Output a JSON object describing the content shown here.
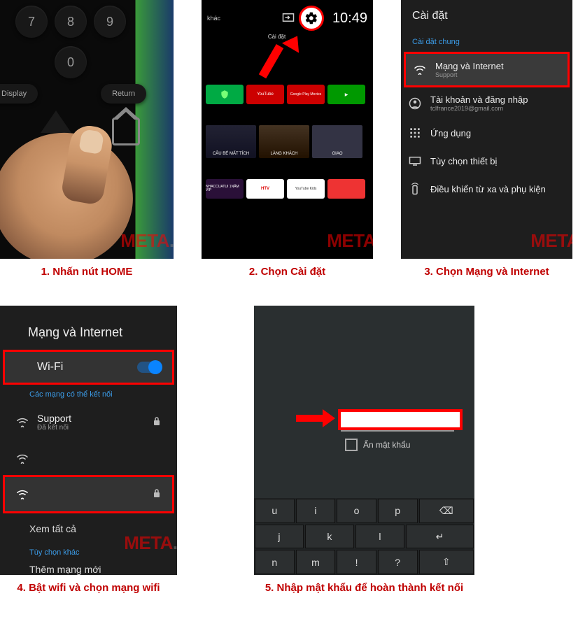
{
  "step1": {
    "caption": "1. Nhấn nút HOME",
    "remote": {
      "keys_row1": [
        "7",
        "8",
        "9"
      ],
      "key_zero": "0",
      "display_btn": "Display",
      "return_btn": "Return"
    }
  },
  "step2": {
    "caption": "2. Chọn Cài đặt",
    "topbar": {
      "khac": "khác",
      "time": "10:49",
      "settings_label": "Cài đặt"
    },
    "apps_row1": [
      {
        "label": "",
        "color": "#0a4"
      },
      {
        "label": "YouTube",
        "color": "#c00"
      },
      {
        "label": "Google Play Movies",
        "color": "#c00"
      },
      {
        "label": "",
        "color": "#090"
      }
    ],
    "posters_row1": [
      {
        "label": "CÂU BÉ MẤT TÍCH"
      },
      {
        "label": "LÀNG KHÁCH"
      },
      {
        "label": "GIAO"
      }
    ],
    "apps_row2": [
      {
        "label": "NHACCUATUI 1NĂM VIP",
        "color": "#2a1038"
      },
      {
        "label": "HTV",
        "color": "#d00"
      },
      {
        "label": "YouTube Kids",
        "color": "#fff"
      },
      {
        "label": "",
        "color": "#e33"
      }
    ]
  },
  "step3": {
    "caption": "3. Chọn Mạng và Internet",
    "header": "Cài đặt",
    "section": "Cài đặt chung",
    "items": [
      {
        "icon": "wifi",
        "title": "Mạng và Internet",
        "sub": "Support",
        "hl": true
      },
      {
        "icon": "account",
        "title": "Tài khoản và đăng nhập",
        "sub": "tclfrance2019@gmail.com"
      },
      {
        "icon": "apps",
        "title": "Ứng dụng"
      },
      {
        "icon": "device",
        "title": "Tùy chọn thiết bị"
      },
      {
        "icon": "remote",
        "title": "Điều khiển từ xa và phụ kiện"
      }
    ]
  },
  "step4": {
    "caption": "4. Bật wifi và chọn mạng wifi",
    "header": "Mạng và Internet",
    "wifi_label": "Wi-Fi",
    "section_available": "Các mạng có thể kết nối",
    "net_support": {
      "name": "Support",
      "sub": "Đã kết nối"
    },
    "see_all": "Xem tất cả",
    "section_other": "Tùy chọn khác",
    "add_network": "Thêm mạng mới"
  },
  "step5": {
    "caption": "5. Nhập mật khẩu để hoàn thành kết nối",
    "hide_pw": "Ẩn mật khẩu",
    "keyboard": {
      "row1": [
        "u",
        "i",
        "o",
        "p",
        "⌫"
      ],
      "row2": [
        "j",
        "k",
        "l",
        "↵"
      ],
      "row3": [
        "n",
        "m",
        "!",
        "?",
        "⇧"
      ]
    }
  },
  "watermark": {
    "m": "META",
    "vn": ".vn"
  }
}
